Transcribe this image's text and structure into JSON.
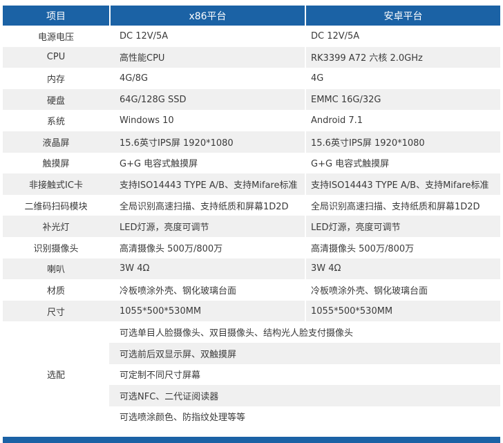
{
  "header": {
    "col_item": "项目",
    "col_x86": "x86平台",
    "col_android": "安卓平台"
  },
  "rows": [
    {
      "label": "电源电压",
      "x86": "DC 12V/5A",
      "android": "DC 12V/5A"
    },
    {
      "label": "CPU",
      "x86": "高性能CPU",
      "android": "RK3399  A72  六核 2.0GHz"
    },
    {
      "label": "内存",
      "x86": "4G/8G",
      "android": "4G"
    },
    {
      "label": "硬盘",
      "x86": "64G/128G SSD",
      "android": "EMMC 16G/32G"
    },
    {
      "label": "系统",
      "x86": "Windows 10",
      "android": "Android 7.1"
    },
    {
      "label": "液晶屏",
      "x86": "15.6英寸IPS屏  1920*1080",
      "android": "15.6英寸IPS屏  1920*1080"
    },
    {
      "label": "触摸屏",
      "x86": "G+G 电容式触摸屏",
      "android": "G+G 电容式触摸屏"
    },
    {
      "label": "非接触式IC卡",
      "x86": "支持ISO14443  TYPE A/B、支持Mifare标准",
      "android": "支持ISO14443  TYPE A/B、支持Mifare标准"
    },
    {
      "label": "二维码扫码模块",
      "x86": "全局识别高速扫描、支持纸质和屏幕1D2D",
      "android": "全局识别高速扫描、支持纸质和屏幕1D2D"
    },
    {
      "label": "补光灯",
      "x86": "LED灯源，亮度可调节",
      "android": "LED灯源，亮度可调节"
    },
    {
      "label": "识别摄像头",
      "x86": "高清摄像头 500万/800万",
      "android": "高清摄像头 500万/800万"
    },
    {
      "label": "喇叭",
      "x86": "3W 4Ω",
      "android": "3W 4Ω"
    },
    {
      "label": "材质",
      "x86": "冷板喷涂外壳、钢化玻璃台面",
      "android": "冷板喷涂外壳、钢化玻璃台面"
    },
    {
      "label": "尺寸",
      "x86": "1055*500*530MM",
      "android": "1055*500*530MM"
    }
  ],
  "options": {
    "label": "选配",
    "items": [
      "可选单目人脸摄像头、双目摄像头、结构光人脸支付摄像头",
      "可选前后双显示屏、双触摸屏",
      "可定制不同尺寸屏幕",
      "可选NFC、二代证阅读器",
      "可选喷涂颜色、防指纹处理等等"
    ]
  }
}
